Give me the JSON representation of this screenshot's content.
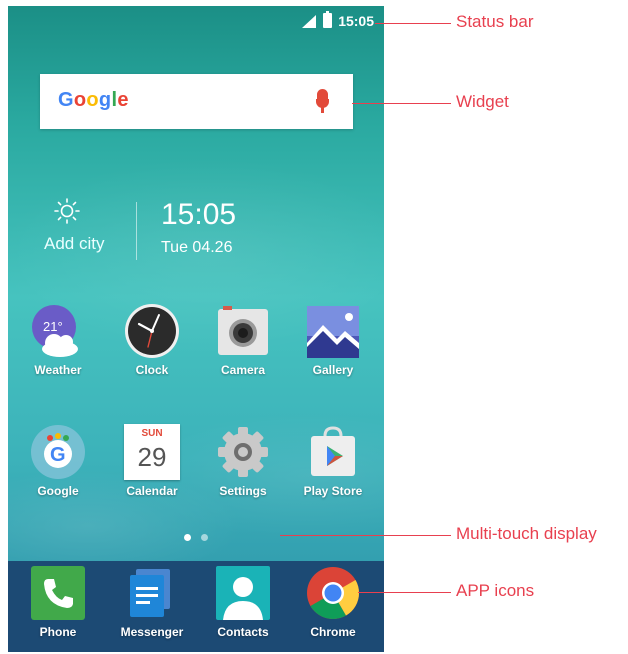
{
  "status_bar": {
    "time": "15:05"
  },
  "search_widget": {
    "logo_text": "Google"
  },
  "weather_widget": {
    "city_placeholder": "Add city",
    "time": "15:05",
    "date": "Tue 04.26"
  },
  "apps_row1": [
    {
      "label": "Weather",
      "badge": "21°",
      "icon": "weather-icon"
    },
    {
      "label": "Clock",
      "icon": "clock-icon"
    },
    {
      "label": "Camera",
      "icon": "camera-icon"
    },
    {
      "label": "Gallery",
      "icon": "gallery-icon"
    }
  ],
  "apps_row2": [
    {
      "label": "Google",
      "icon": "google-app-icon"
    },
    {
      "label": "Calendar",
      "month": "SUN",
      "day": "29",
      "icon": "calendar-icon"
    },
    {
      "label": "Settings",
      "icon": "settings-icon"
    },
    {
      "label": "Play Store",
      "icon": "play-store-icon"
    }
  ],
  "dock": [
    {
      "label": "Phone",
      "icon": "phone-icon"
    },
    {
      "label": "Messenger",
      "icon": "messenger-icon"
    },
    {
      "label": "Contacts",
      "icon": "contacts-icon"
    },
    {
      "label": "Chrome",
      "icon": "chrome-icon"
    }
  ],
  "annotations": {
    "status_bar": "Status bar",
    "widget": "Widget",
    "multi_touch": "Multi-touch display",
    "app_icons": "APP icons"
  },
  "colors": {
    "annotation": "#e8404f",
    "dock": "#1c4a74",
    "wallpaper": "#46c3bf"
  }
}
